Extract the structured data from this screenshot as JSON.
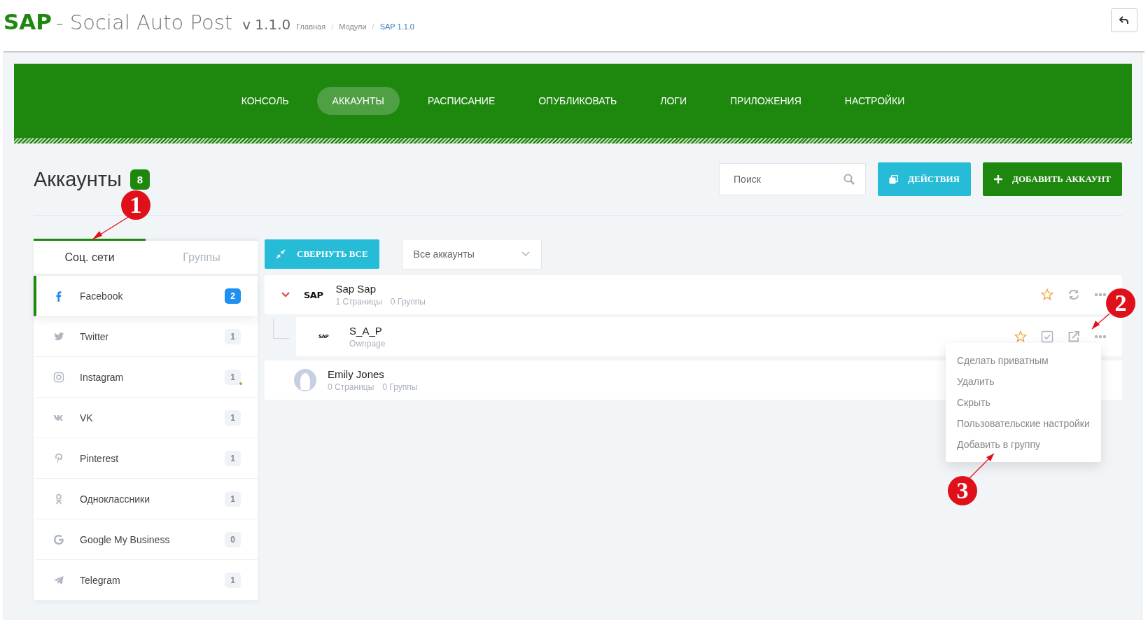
{
  "header": {
    "brand": "SAP",
    "title": "- Social Auto Post",
    "version": "v 1.1.0",
    "separator": "/",
    "breadcrumbs": [
      {
        "label": "Главная",
        "current": false
      },
      {
        "label": "Модули",
        "current": false
      },
      {
        "label": "SAP 1.1.0",
        "current": true
      }
    ]
  },
  "nav": [
    {
      "label": "КОНСОЛЬ",
      "selected": false
    },
    {
      "label": "АККАУНТЫ",
      "selected": true
    },
    {
      "label": "РАСПИСАНИЕ",
      "selected": false
    },
    {
      "label": "ОПУБЛИКОВАТЬ",
      "selected": false
    },
    {
      "label": "ЛОГИ",
      "selected": false
    },
    {
      "label": "ПРИЛОЖЕНИЯ",
      "selected": false
    },
    {
      "label": "НАСТРОЙКИ",
      "selected": false
    }
  ],
  "page": {
    "title": "Аккаунты",
    "count": "8",
    "search": {
      "placeholder": "Поиск"
    },
    "actions_button": "ДЕЙСТВИЯ",
    "add_button": "ДОБАВИТЬ АККАУНТ"
  },
  "sidebar": {
    "tabs": [
      {
        "label": "Соц. сети",
        "selected": true
      },
      {
        "label": "Группы",
        "selected": false
      }
    ],
    "items": [
      {
        "kind": "facebook",
        "name": "Facebook",
        "count": "2",
        "selected": true,
        "online": false
      },
      {
        "kind": "twitter",
        "name": "Twitter",
        "count": "1",
        "selected": false,
        "online": false
      },
      {
        "kind": "instagram",
        "name": "Instagram",
        "count": "1",
        "selected": false,
        "online": true
      },
      {
        "kind": "vk",
        "name": "VK",
        "count": "1",
        "selected": false,
        "online": false
      },
      {
        "kind": "pinterest",
        "name": "Pinterest",
        "count": "1",
        "selected": false,
        "online": false
      },
      {
        "kind": "ok",
        "name": "Одноклассники",
        "count": "1",
        "selected": false,
        "online": false
      },
      {
        "kind": "google",
        "name": "Google My Business",
        "count": "0",
        "selected": false,
        "online": false
      },
      {
        "kind": "telegram",
        "name": "Telegram",
        "count": "1",
        "selected": false,
        "online": false
      }
    ]
  },
  "toolbar": {
    "collapse_button": "СВЕРНУТЬ ВСЕ",
    "filter": "Все аккаунты"
  },
  "accounts": [
    {
      "avatar": {
        "kind": "logo",
        "text": "SAP"
      },
      "name": "Sap Sap",
      "meta": [
        "1 Страницы",
        "0 Группы"
      ],
      "expanded": true,
      "actions": [
        {
          "kind": "star"
        },
        {
          "kind": "refresh"
        },
        {
          "kind": "more"
        }
      ],
      "children": [
        {
          "avatar": {
            "kind": "logo",
            "text": "SAP"
          },
          "name": "S_A_P",
          "meta": [
            "Ownpage"
          ],
          "actions": [
            {
              "kind": "star"
            },
            {
              "kind": "check"
            },
            {
              "kind": "external"
            },
            {
              "kind": "more"
            }
          ]
        }
      ]
    },
    {
      "avatar": {
        "kind": "person"
      },
      "name": "Emily Jones",
      "meta": [
        "0 Страницы",
        "0 Группы"
      ],
      "expanded": false
    }
  ],
  "menu": {
    "items": [
      "Сделать приватным",
      "Удалить",
      "Скрыть",
      "Пользовательские настройки",
      "Добавить в группу"
    ]
  },
  "annotations": [
    {
      "number": "1"
    },
    {
      "number": "2"
    },
    {
      "number": "3"
    }
  ]
}
